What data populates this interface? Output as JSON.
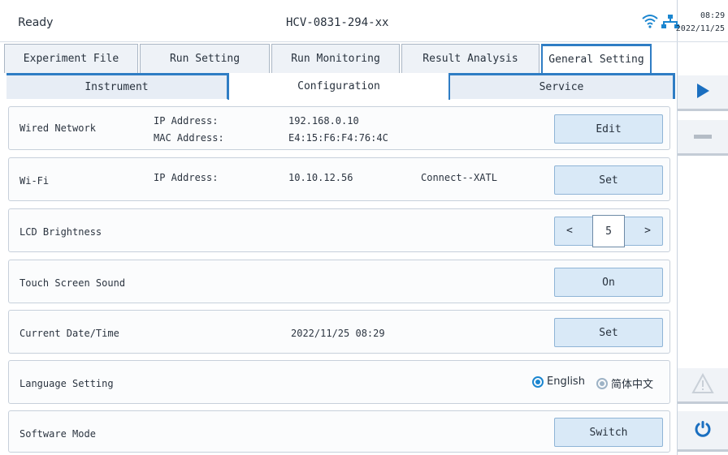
{
  "status": {
    "state": "Ready",
    "device": "HCV-0831-294-xx",
    "time": "08:29",
    "date": "2022/11/25"
  },
  "top_tabs": [
    {
      "label": "Experiment File",
      "active": false
    },
    {
      "label": "Run Setting",
      "active": false
    },
    {
      "label": "Run Monitoring",
      "active": false
    },
    {
      "label": "Result Analysis",
      "active": false
    },
    {
      "label": "General Setting",
      "active": true
    }
  ],
  "sub_tabs": [
    {
      "label": "Instrument",
      "active": false
    },
    {
      "label": "Configuration",
      "active": true
    },
    {
      "label": "Service",
      "active": false
    }
  ],
  "rows": {
    "wired": {
      "label": "Wired Network",
      "ip_label": "IP Address:",
      "ip_value": "192.168.0.10",
      "mac_label": "MAC Address:",
      "mac_value": "E4:15:F6:F4:76:4C",
      "button": "Edit"
    },
    "wifi": {
      "label": "Wi-Fi",
      "ip_label": "IP Address:",
      "ip_value": "10.10.12.56",
      "connection": "Connect--XATL",
      "button": "Set"
    },
    "lcd": {
      "label": "LCD Brightness",
      "prev": "<",
      "value": "5",
      "next": ">"
    },
    "sound": {
      "label": "Touch Screen Sound",
      "button": "On"
    },
    "datetime": {
      "label": "Current Date/Time",
      "value": "2022/11/25 08:29",
      "button": "Set"
    },
    "language": {
      "label": "Language Setting",
      "options": [
        {
          "label": "English",
          "selected": true
        },
        {
          "label": "简体中文",
          "selected": false
        }
      ]
    },
    "mode": {
      "label": "Software Mode",
      "button": "Switch"
    }
  },
  "colors": {
    "accent": "#2f7dc4",
    "button_bg": "#d9e9f7",
    "radio": "#1b86d0"
  },
  "icons": [
    "wifi-icon",
    "network-icon",
    "play-icon",
    "stop-icon",
    "warning-icon",
    "power-icon"
  ]
}
